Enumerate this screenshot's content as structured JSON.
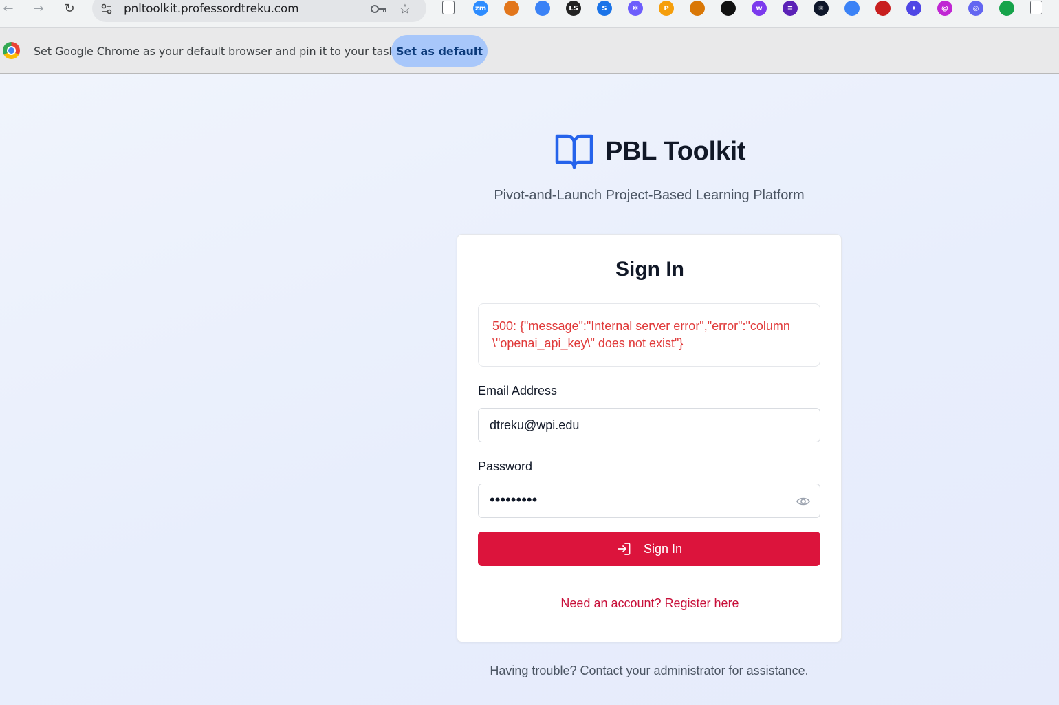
{
  "browser": {
    "url": "pnltoolkit.professordtreku.com",
    "back_icon": "←",
    "forward_icon": "→",
    "reload_icon": "↻",
    "star_icon": "☆",
    "extensions": [
      {
        "name": "page-icon",
        "glyph": "",
        "color": "#ffffff"
      },
      {
        "name": "zoom-icon",
        "glyph": "zm",
        "color": "#2d8cff"
      },
      {
        "name": "metamask-icon",
        "glyph": "",
        "color": "#e2761b"
      },
      {
        "name": "graduation-icon",
        "glyph": "",
        "color": "#3b82f6"
      },
      {
        "name": "ls-icon",
        "glyph": "LS",
        "color": "#222222"
      },
      {
        "name": "s-icon",
        "glyph": "S",
        "color": "#1a73e8"
      },
      {
        "name": "flower-icon",
        "glyph": "✻",
        "color": "#6d5dfc"
      },
      {
        "name": "p-icon",
        "glyph": "P",
        "color": "#f59e0b"
      },
      {
        "name": "avatar-ext-icon",
        "glyph": "",
        "color": "#d97706"
      },
      {
        "name": "green-arrow-icon",
        "glyph": "",
        "color": "#111111"
      },
      {
        "name": "purple-w-icon",
        "glyph": "w",
        "color": "#7c3aed"
      },
      {
        "name": "list-icon",
        "glyph": "≡",
        "color": "#5b21b6"
      },
      {
        "name": "react-icon",
        "glyph": "⚛",
        "color": "#0f172a"
      },
      {
        "name": "chart-ext-icon",
        "glyph": "",
        "color": "#3b82f6"
      },
      {
        "name": "pdf-icon",
        "glyph": "",
        "color": "#c81e1e"
      },
      {
        "name": "gemini-icon",
        "glyph": "✦",
        "color": "#4f46e5"
      },
      {
        "name": "spiral-icon",
        "glyph": "@",
        "color": "#c026d3"
      },
      {
        "name": "circle-ext-icon",
        "glyph": "◎",
        "color": "#6366f1"
      },
      {
        "name": "robot-icon",
        "glyph": "",
        "color": "#16a34a"
      },
      {
        "name": "puzzle-icon",
        "glyph": "",
        "color": "#ffffff"
      }
    ]
  },
  "infobar": {
    "message": "Set Google Chrome as your default browser and pin it to your taskbar",
    "button_label": "Set as default"
  },
  "page": {
    "brand_name": "PBL Toolkit",
    "tagline": "Pivot-and-Launch Project-Based Learning Platform",
    "card_title": "Sign In",
    "error_message": "500: {\"message\":\"Internal server error\",\"error\":\"column \\\"openai_api_key\\\" does not exist\"}",
    "email_label": "Email Address",
    "email_value": "dtreku@wpi.edu",
    "password_label": "Password",
    "password_mask": "•••••••••",
    "signin_label": "Sign In",
    "register_link": "Need an account? Register here",
    "help_text": "Having trouble? Contact your administrator for assistance.",
    "accent_color": "#dc143c",
    "brand_color": "#2563eb"
  }
}
